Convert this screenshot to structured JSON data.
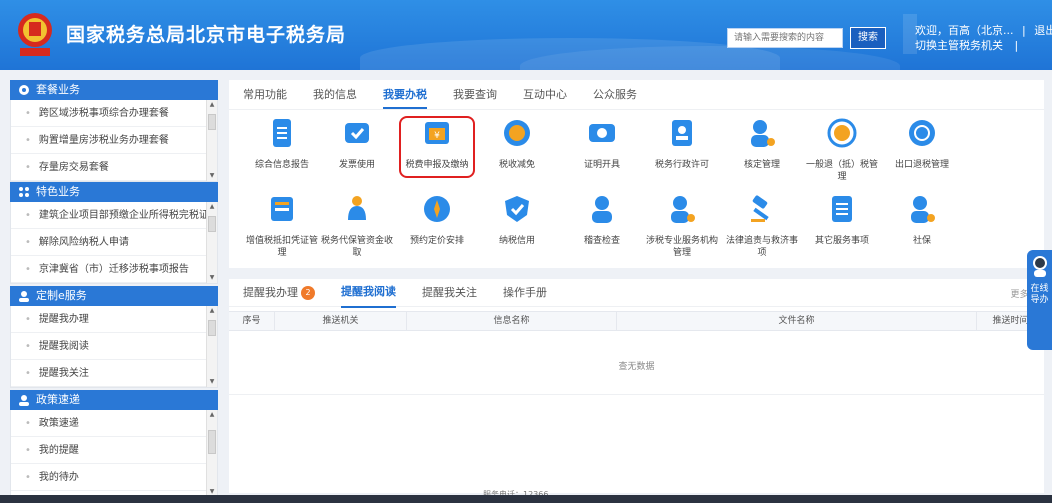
{
  "header": {
    "title": "国家税务总局北京市电子税务局",
    "search_placeholder": "请输入需要搜索的内容",
    "search_button": "搜索",
    "welcome": "欢迎，百高（北京...",
    "logout": "退出",
    "switch_org": "切换主管税务机关"
  },
  "sidebar": {
    "sections": [
      {
        "title": "套餐业务",
        "icon": "package-icon",
        "items": [
          "跨区域涉税事项综合办理套餐",
          "购置增量房涉税业务办理套餐",
          "存量房交易套餐"
        ]
      },
      {
        "title": "特色业务",
        "icon": "feature-icon",
        "items": [
          "建筑企业项目部预缴企业所得税完税证明...",
          "解除风险纳税人申请",
          "京津冀省（市）迁移涉税事项报告"
        ]
      },
      {
        "title": "定制e服务",
        "icon": "person-icon",
        "items": [
          "提醒我办理",
          "提醒我阅读",
          "提醒我关注"
        ]
      },
      {
        "title": "政策速递",
        "icon": "person-icon",
        "items": [
          "政策速递",
          "我的提醒",
          "我的待办"
        ]
      }
    ]
  },
  "top_tabs": [
    "常用功能",
    "我的信息",
    "我要办税",
    "我要查询",
    "互动中心",
    "公众服务"
  ],
  "active_top_tab": "我要办税",
  "functions": [
    {
      "label": "综合信息报告",
      "icon": "report-icon",
      "color": "#2b8be8"
    },
    {
      "label": "发票使用",
      "icon": "invoice-icon",
      "color": "#2b8be8"
    },
    {
      "label": "税费申报及缴纳",
      "icon": "tax-payment-icon",
      "color": "#2b8be8"
    },
    {
      "label": "税收减免",
      "icon": "coin-icon",
      "color": "#f3a321"
    },
    {
      "label": "证明开具",
      "icon": "certificate-icon",
      "color": "#2b8be8"
    },
    {
      "label": "税务行政许可",
      "icon": "license-icon",
      "color": "#2b8be8"
    },
    {
      "label": "核定管理",
      "icon": "user-gear-icon",
      "color": "#2b8be8"
    },
    {
      "label": "一般退（抵）税管理",
      "icon": "refund-icon",
      "color": "#f3a321"
    },
    {
      "label": "出口退税管理",
      "icon": "globe-icon",
      "color": "#2b8be8"
    },
    {
      "label": "增值税抵扣凭证管理",
      "icon": "ledger-icon",
      "color": "#2b8be8"
    },
    {
      "label": "税务代保管资金收取",
      "icon": "money-bag-icon",
      "color": "#2b8be8"
    },
    {
      "label": "预约定价安排",
      "icon": "compass-icon",
      "color": "#2b8be8"
    },
    {
      "label": "纳税信用",
      "icon": "shield-check-icon",
      "color": "#2b8be8"
    },
    {
      "label": "稽查检查",
      "icon": "inspector-icon",
      "color": "#2b8be8"
    },
    {
      "label": "涉税专业服务机构管理",
      "icon": "agency-icon",
      "color": "#2b8be8"
    },
    {
      "label": "法律追责与救济事项",
      "icon": "gavel-icon",
      "color": "#2b8be8"
    },
    {
      "label": "其它服务事项",
      "icon": "list-icon",
      "color": "#2b8be8"
    },
    {
      "label": "社保",
      "icon": "social-security-icon",
      "color": "#2b8be8"
    }
  ],
  "messages": {
    "tabs": [
      "提醒我办理",
      "提醒我阅读",
      "提醒我关注",
      "操作手册"
    ],
    "active_tab": "提醒我阅读",
    "badge_count": "2",
    "more": "更多>",
    "columns": [
      "序号",
      "推送机关",
      "信息名称",
      "文件名称",
      "推送时间"
    ],
    "empty_text": "查无数据"
  },
  "footer": {
    "partial_text": "服务电话：12366"
  },
  "help": {
    "label": "在线导办"
  },
  "colors": {
    "header_blue": "#2a80e0",
    "accent": "#1f6fd1",
    "badge": "#f07a2a",
    "highlight": "#e02020"
  }
}
